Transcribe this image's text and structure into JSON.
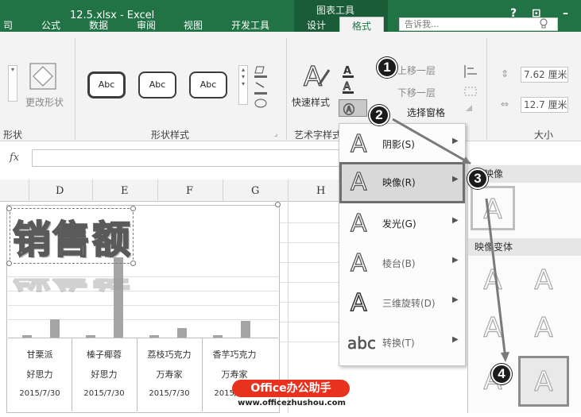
{
  "window": {
    "title": "12.5.xlsx - Excel",
    "context_tab_group": "图表工具",
    "help": "?",
    "restore": "⊡",
    "minimize": "–"
  },
  "tabs": [
    "司",
    "公式",
    "数据",
    "审阅",
    "视图",
    "开发工具",
    "设计",
    "格式"
  ],
  "tell_me": {
    "placeholder": "告诉我...",
    "icon": "lightbulb-icon"
  },
  "ribbon": {
    "shape_group": {
      "change_shape": "更改形状",
      "label": "形状"
    },
    "styles_group": {
      "presets": [
        "Abc",
        "Abc",
        "Abc"
      ],
      "label": "形状样式"
    },
    "wordart_group": {
      "quick_styles": "快速样式",
      "label": "艺术字样式"
    },
    "arrange_group": {
      "bring_forward": "上移一层",
      "send_backward": "下移一层",
      "selection_pane": "选择窗格"
    },
    "size_group": {
      "height": "7.62 厘米",
      "width": "12.7 厘米",
      "label": "大小"
    }
  },
  "formula_bar": {
    "fx": "fx",
    "value": ""
  },
  "columns": [
    "D",
    "E",
    "F",
    "G",
    "H"
  ],
  "chart": {
    "title_wordart": "销售额",
    "categories": [
      {
        "name": "甘栗派",
        "brand": "好思力",
        "date": "2015/7/30"
      },
      {
        "name": "榛子椰蓉",
        "brand": "好思力",
        "date": "2015/7/30"
      },
      {
        "name": "荔枝巧克力",
        "brand": "万寿家",
        "date": "2015/7/30"
      },
      {
        "name": "香芋巧克力",
        "brand": "万寿家",
        "date": "2015/7/30"
      }
    ],
    "bar_color": "#a5a5a5"
  },
  "text_effects_menu": {
    "items": [
      {
        "glyph": "A",
        "label": "阴影(S)",
        "enabled": true
      },
      {
        "glyph": "A",
        "label": "映像(R)",
        "enabled": true,
        "active": true
      },
      {
        "glyph": "A",
        "label": "发光(G)",
        "enabled": true
      },
      {
        "glyph": "A",
        "label": "棱台(B)",
        "enabled": false
      },
      {
        "glyph": "A",
        "label": "三维旋转(D)",
        "enabled": false
      },
      {
        "glyph": "abc",
        "label": "转换(T)",
        "enabled": false
      }
    ]
  },
  "reflection_submenu": {
    "no_reflection_header": "无映像",
    "variants_header": "映像变体",
    "tile_glyph": "A"
  },
  "callouts": [
    "1",
    "2",
    "3",
    "4"
  ],
  "watermark": {
    "brand": "Office办公助手",
    "url": "www.officezhushou.com"
  }
}
